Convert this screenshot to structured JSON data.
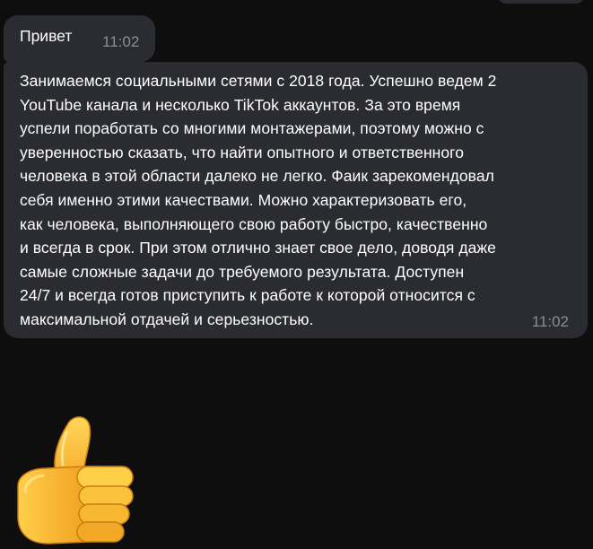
{
  "messages": [
    {
      "text": "Привет",
      "time": "11:02"
    },
    {
      "text": "Занимаемся социальными сетями с 2018 года. Успешно ведем 2\nYouTube канала и несколько TikTok аккаунтов. За это время\nуспели поработать со многими монтажерами, поэтому можно с\nуверенностью сказать, что найти  опытного и ответственного\nчеловека в этой области далеко не легко. Фаик  зарекомендовал\nсебя именно этими качествами. Можно характеризовать его,\nкак человека, выполняющего свою работу быстро, качественно\nи всегда в срок. При этом отлично знает свое дело, доводя даже\nсамые сложные задачи до требуемого результата. Доступен\n24/7 и всегда готов приступить к работе к которой относится с\nмаксимальной отдачей и серьезностью.",
      "time": "11:02"
    }
  ],
  "sticker": {
    "icon": "thumbs-up-icon"
  },
  "colors": {
    "background": "#0e0e0f",
    "bubble": "#2b2c31",
    "text": "#ffffff",
    "time": "#8d8e93",
    "thumb": "#ffc83d"
  }
}
